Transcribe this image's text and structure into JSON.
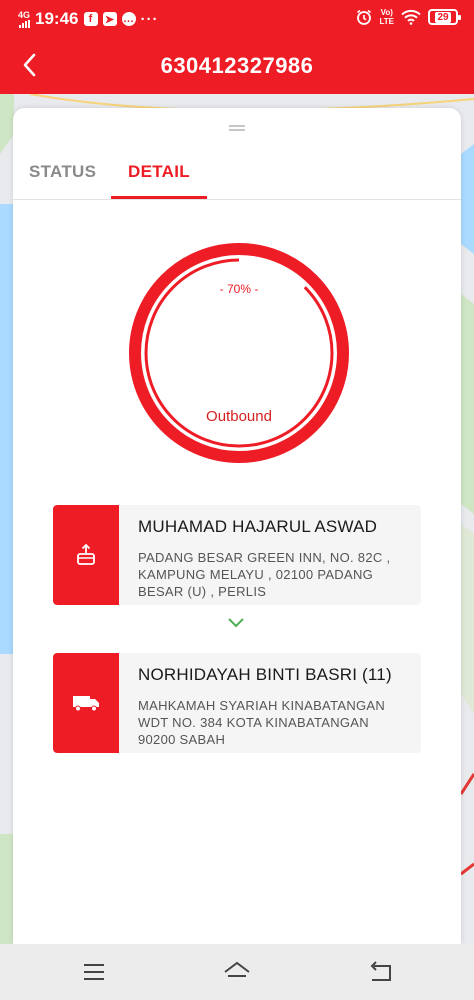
{
  "status_bar": {
    "network": "4G",
    "time": "19:46",
    "volte": "Vo)",
    "lte": "LTE",
    "battery": "29"
  },
  "header": {
    "title": "630412327986"
  },
  "tabs": [
    {
      "label": "STATUS",
      "active": false
    },
    {
      "label": "DETAIL",
      "active": true
    }
  ],
  "progress": {
    "percent_label": "- 70% -",
    "value": 70,
    "stage": "Outbound"
  },
  "sender": {
    "name": "MUHAMAD HAJARUL ASWAD",
    "address": "PADANG BESAR GREEN INN, NO. 82C , KAMPUNG MELAYU , 02100 PADANG BESAR (U) , PERLIS",
    "icon": "parcel-pickup-icon"
  },
  "receiver": {
    "name": "NORHIDAYAH BINTI BASRI (11)",
    "address": "MAHKAMAH SYARIAH KINABATANGAN WDT NO. 384 KOTA KINABATANGAN 90200 SABAH",
    "icon": "delivery-truck-icon"
  },
  "colors": {
    "brand": "#ee1c25",
    "chevron": "#4caf50"
  }
}
